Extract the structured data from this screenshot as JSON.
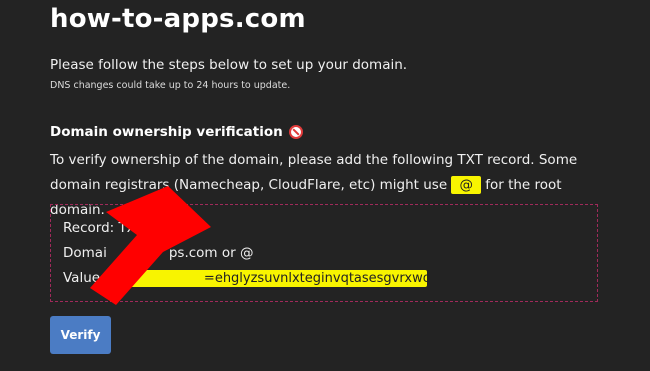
{
  "header": {
    "title": "how-to-apps.com"
  },
  "intro": {
    "text": "Please follow the steps below to set up your domain.",
    "note": "DNS changes could take up to 24 hours to update."
  },
  "verification": {
    "title": "Domain ownership verification",
    "title_icon": "no-entry-icon",
    "text_before": "To verify ownership of the domain, please add the following TXT record. Some domain registrars (Namecheap, CloudFlare, etc) might use ",
    "root_symbol": "@",
    "text_after": " for the root domain."
  },
  "record": {
    "record_line": "Record: TX",
    "domain_prefix": "Domai",
    "domain_suffix": "ps.com or @",
    "value_label": "Value:",
    "value_visible": "=ehglyzsuvnlxteginvqtasesgvrxwo"
  },
  "actions": {
    "verify_label": "Verify"
  },
  "colors": {
    "background": "#232323",
    "highlight": "#f8f400",
    "button": "#4b7cc4",
    "arrow": "#ff0000",
    "box_border": "#a02a5a"
  }
}
